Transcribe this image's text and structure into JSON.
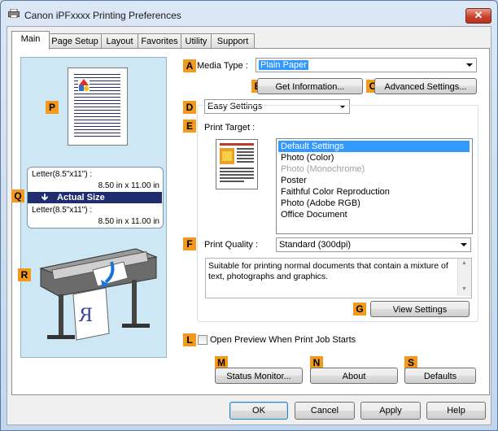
{
  "window": {
    "title": "Canon iPFxxxx Printing Preferences",
    "close_glyph": "✕"
  },
  "tabs": [
    {
      "label": "Main"
    },
    {
      "label": "Page Setup"
    },
    {
      "label": "Layout"
    },
    {
      "label": "Favorites"
    },
    {
      "label": "Utility"
    },
    {
      "label": "Support"
    }
  ],
  "markers": {
    "A": "A",
    "B": "B",
    "C": "C",
    "D": "D",
    "E": "E",
    "F": "F",
    "G": "G",
    "L": "L",
    "M": "M",
    "N": "N",
    "S": "S",
    "P": "P",
    "Q": "Q",
    "R": "R"
  },
  "preview": {
    "paper_label_top": "Letter(8.5\"x11\") :",
    "paper_dims_top": "8.50 in x 11.00 in",
    "actual_size": "Actual Size",
    "paper_label_bottom": "Letter(8.5\"x11\") :",
    "paper_dims_bottom": "8.50 in x 11.00 in"
  },
  "media_type": {
    "label": "Media Type :",
    "value": "Plain Paper"
  },
  "buttons": {
    "get_information": "Get Information...",
    "advanced_settings": "Advanced Settings...",
    "view_settings": "View Settings",
    "status_monitor": "Status Monitor...",
    "about": "About",
    "defaults": "Defaults",
    "ok": "OK",
    "cancel": "Cancel",
    "apply": "Apply",
    "help": "Help"
  },
  "settings_mode": {
    "value": "Easy Settings"
  },
  "print_target": {
    "label": "Print Target :",
    "items": [
      {
        "label": "Default Settings",
        "state": "selected"
      },
      {
        "label": "Photo (Color)",
        "state": "normal"
      },
      {
        "label": "Photo (Monochrome)",
        "state": "disabled"
      },
      {
        "label": "Poster",
        "state": "normal"
      },
      {
        "label": "Faithful Color Reproduction",
        "state": "normal"
      },
      {
        "label": "Photo (Adobe RGB)",
        "state": "normal"
      },
      {
        "label": "Office Document",
        "state": "normal"
      }
    ]
  },
  "print_quality": {
    "label": "Print Quality :",
    "value": "Standard (300dpi)"
  },
  "description": "Suitable for printing normal documents that contain a mixture of text, photographs and graphics.",
  "open_preview": {
    "label": "Open Preview When Print Job Starts",
    "checked": false
  },
  "colors": {
    "marker": "#f39a1e",
    "selection": "#3399ff",
    "actual_size_bar": "#1f2c6e",
    "preview_bg": "#cde8f4"
  }
}
